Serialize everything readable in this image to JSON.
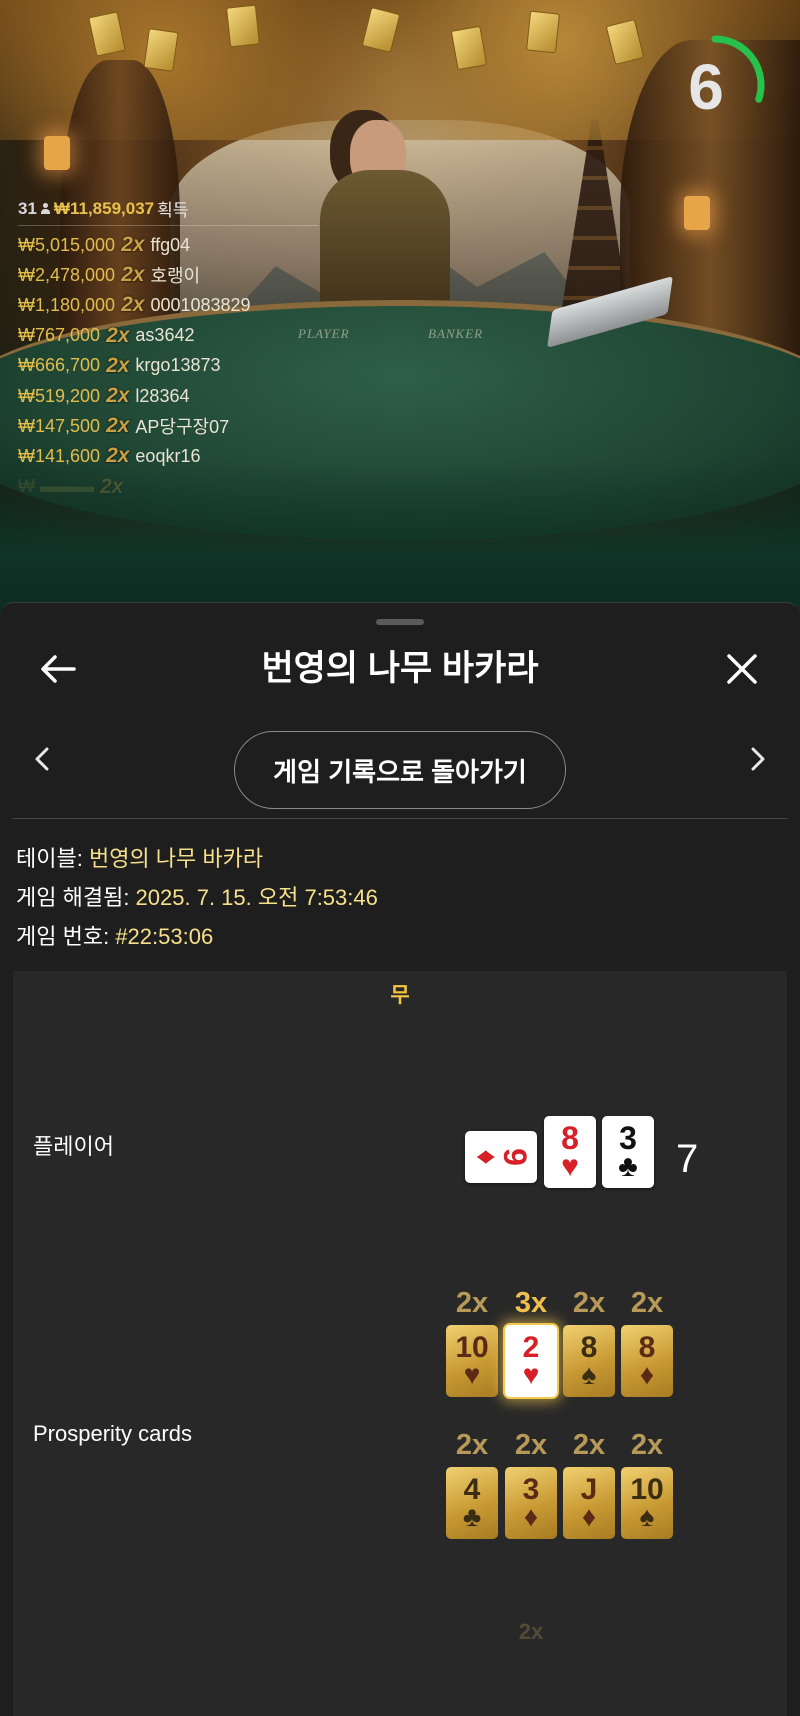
{
  "colors": {
    "accent_gold": "#e2bd4c",
    "outcome_yellow": "#f2c542",
    "timer_green": "#27c24c",
    "panel_bg": "#1e1e1e",
    "card_red": "#d61f26"
  },
  "timer": {
    "value": "6",
    "remaining_fraction": 0.3
  },
  "scene": {
    "table_player_label": "PLAYER",
    "table_banker_label": "BANKER"
  },
  "winners": {
    "count": "31",
    "total": "₩11,859,037",
    "label": "획득",
    "rows": [
      {
        "amount": "₩5,015,000",
        "mult": "2x",
        "user": "ffg04"
      },
      {
        "amount": "₩2,478,000",
        "mult": "2x",
        "user": "호랭이"
      },
      {
        "amount": "₩1,180,000",
        "mult": "2x",
        "user": "0001083829"
      },
      {
        "amount": "₩767,000",
        "mult": "2x",
        "user": "as3642"
      },
      {
        "amount": "₩666,700",
        "mult": "2x",
        "user": "krgo13873"
      },
      {
        "amount": "₩519,200",
        "mult": "2x",
        "user": "l28364"
      },
      {
        "amount": "₩147,500",
        "mult": "2x",
        "user": "AP당구장07"
      },
      {
        "amount": "₩141,600",
        "mult": "2x",
        "user": "eoqkr16"
      }
    ]
  },
  "panel": {
    "title": "번영의 나무 바카라",
    "history_button": "게임 기록으로 돌아가기",
    "info": {
      "table_label": "테이블: ",
      "table_value": "번영의 나무 바카라",
      "resolved_label": "게임 해결됨: ",
      "resolved_value": "2025. 7. 15. 오전 7:53:46",
      "number_label": "게임 번호: ",
      "number_value": "#22:53:06"
    },
    "outcome": "무",
    "player": {
      "label": "플레이어",
      "cards": [
        {
          "rank": "9",
          "suit": "♦"
        },
        {
          "rank": "8",
          "suit": "♥"
        },
        {
          "rank": "3",
          "suit": "♣"
        }
      ],
      "total": "7"
    },
    "prosperity": {
      "label": "Prosperity cards",
      "row1": [
        {
          "mult": "2x",
          "rank": "10",
          "suit": "♥"
        },
        {
          "mult": "3x",
          "rank": "2",
          "suit": "♥"
        },
        {
          "mult": "2x",
          "rank": "8",
          "suit": "♠"
        },
        {
          "mult": "2x",
          "rank": "8",
          "suit": "♦"
        }
      ],
      "row2": [
        {
          "mult": "2x",
          "rank": "4",
          "suit": "♣"
        },
        {
          "mult": "2x",
          "rank": "3",
          "suit": "♦"
        },
        {
          "mult": "2x",
          "rank": "J",
          "suit": "♦"
        },
        {
          "mult": "2x",
          "rank": "10",
          "suit": "♠"
        }
      ],
      "next_mult": "2x"
    },
    "icons": {
      "back": "arrow-left-icon",
      "close": "close-icon",
      "prev": "chevron-left-icon",
      "next": "chevron-right-icon"
    }
  }
}
